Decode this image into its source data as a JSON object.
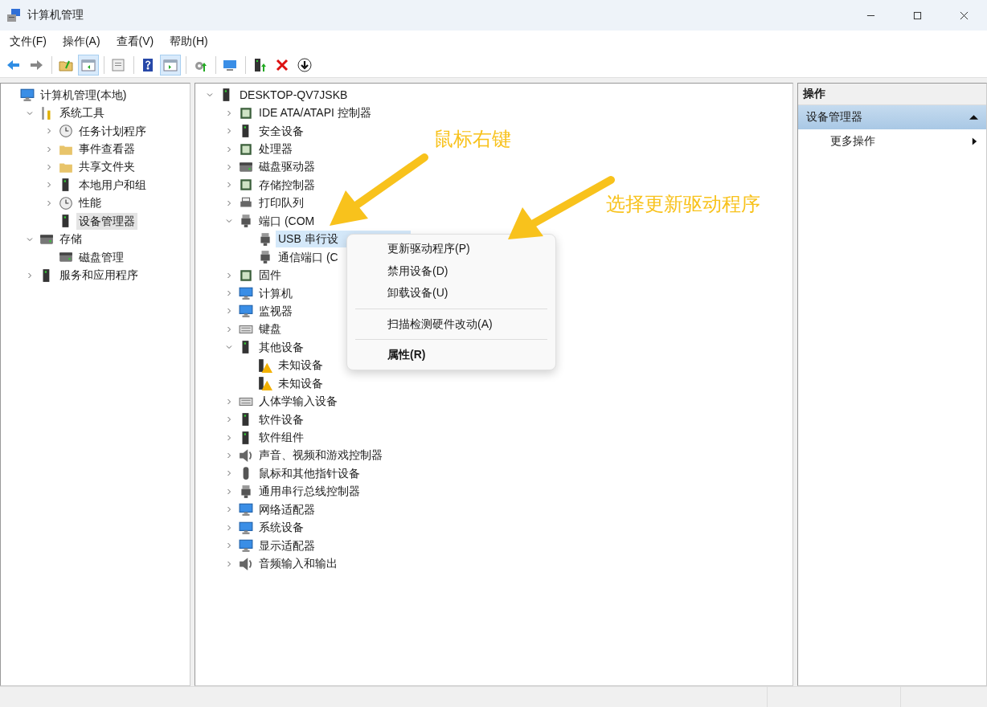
{
  "window": {
    "title": "计算机管理"
  },
  "menu": [
    {
      "label": "文件(F)"
    },
    {
      "label": "操作(A)"
    },
    {
      "label": "查看(V)"
    },
    {
      "label": "帮助(H)"
    }
  ],
  "toolbar": [
    {
      "kind": "button",
      "on": false
    },
    {
      "kind": "button",
      "on": false
    },
    {
      "kind": "separator"
    },
    {
      "kind": "button",
      "on": false
    },
    {
      "kind": "button",
      "on": true
    },
    {
      "kind": "separator"
    },
    {
      "kind": "button",
      "on": false
    },
    {
      "kind": "separator"
    },
    {
      "kind": "button",
      "on": false
    },
    {
      "kind": "button",
      "on": true
    },
    {
      "kind": "separator"
    },
    {
      "kind": "button",
      "on": false
    },
    {
      "kind": "separator"
    },
    {
      "kind": "button",
      "on": false
    },
    {
      "kind": "separator"
    },
    {
      "kind": "button",
      "on": false
    },
    {
      "kind": "button",
      "on": false
    },
    {
      "kind": "button",
      "on": false
    }
  ],
  "console_tree": {
    "root": {
      "label": "计算机管理(本地)",
      "selected": false,
      "children": [
        {
          "label": "系统工具",
          "selected": false,
          "expanded": true,
          "children": [
            {
              "label": "任务计划程序",
              "selected": false,
              "expanded": false
            },
            {
              "label": "事件查看器",
              "selected": false,
              "expanded": false
            },
            {
              "label": "共享文件夹",
              "selected": false,
              "expanded": false
            },
            {
              "label": "本地用户和组",
              "selected": false,
              "expanded": false
            },
            {
              "label": "性能",
              "selected": false,
              "expanded": false
            },
            {
              "label": "设备管理器",
              "selected": true
            }
          ]
        },
        {
          "label": "存储",
          "selected": false,
          "expanded": true,
          "children": [
            {
              "label": "磁盘管理",
              "selected": false
            }
          ]
        },
        {
          "label": "服务和应用程序",
          "selected": false,
          "expanded": false
        }
      ]
    }
  },
  "device_tree": {
    "root": {
      "label": "DESKTOP-QV7JSKB",
      "selected": false,
      "expanded": true,
      "children": [
        {
          "label": "IDE ATA/ATAPI 控制器",
          "selected": false,
          "expanded": false
        },
        {
          "label": "安全设备",
          "selected": false,
          "expanded": false
        },
        {
          "label": "处理器",
          "selected": false,
          "expanded": false
        },
        {
          "label": "磁盘驱动器",
          "selected": false,
          "expanded": false
        },
        {
          "label": "存储控制器",
          "selected": false,
          "expanded": false
        },
        {
          "label": "打印队列",
          "selected": false,
          "expanded": false
        },
        {
          "label": "端口 (COM",
          "selected": false,
          "expanded": true,
          "children": [
            {
              "label": "USB 串行设",
              "selected": true
            },
            {
              "label": "通信端口 (C",
              "selected": false
            }
          ]
        },
        {
          "label": "固件",
          "selected": false,
          "expanded": false
        },
        {
          "label": "计算机",
          "selected": false,
          "expanded": false
        },
        {
          "label": "监视器",
          "selected": false,
          "expanded": false
        },
        {
          "label": "键盘",
          "selected": false,
          "expanded": false
        },
        {
          "label": "其他设备",
          "selected": false,
          "expanded": true,
          "children": [
            {
              "label": "未知设备",
              "selected": false
            },
            {
              "label": "未知设备",
              "selected": false
            }
          ]
        },
        {
          "label": "人体学输入设备",
          "selected": false,
          "expanded": false
        },
        {
          "label": "软件设备",
          "selected": false,
          "expanded": false
        },
        {
          "label": "软件组件",
          "selected": false,
          "expanded": false
        },
        {
          "label": "声音、视频和游戏控制器",
          "selected": false,
          "expanded": false
        },
        {
          "label": "鼠标和其他指针设备",
          "selected": false,
          "expanded": false
        },
        {
          "label": "通用串行总线控制器",
          "selected": false,
          "expanded": false
        },
        {
          "label": "网络适配器",
          "selected": false,
          "expanded": false
        },
        {
          "label": "系统设备",
          "selected": false,
          "expanded": false
        },
        {
          "label": "显示适配器",
          "selected": false,
          "expanded": false
        },
        {
          "label": "音频输入和输出",
          "selected": false,
          "expanded": false
        }
      ]
    }
  },
  "context_menu": {
    "items": [
      {
        "kind": "item",
        "label": "更新驱动程序(P)",
        "default": false
      },
      {
        "kind": "item",
        "label": "禁用设备(D)",
        "default": false
      },
      {
        "kind": "item",
        "label": "卸载设备(U)",
        "default": false
      },
      {
        "kind": "separator"
      },
      {
        "kind": "item",
        "label": "扫描检测硬件改动(A)",
        "default": false
      },
      {
        "kind": "separator"
      },
      {
        "kind": "item",
        "label": "属性(R)",
        "default": true
      }
    ]
  },
  "actions_pane": {
    "header": "操作",
    "section": {
      "label": "设备管理器",
      "expanded": true
    },
    "items": [
      {
        "label": "更多操作"
      }
    ]
  },
  "annotations": [
    {
      "text": "鼠标右键"
    },
    {
      "text": "选择更新驱动程序"
    }
  ]
}
